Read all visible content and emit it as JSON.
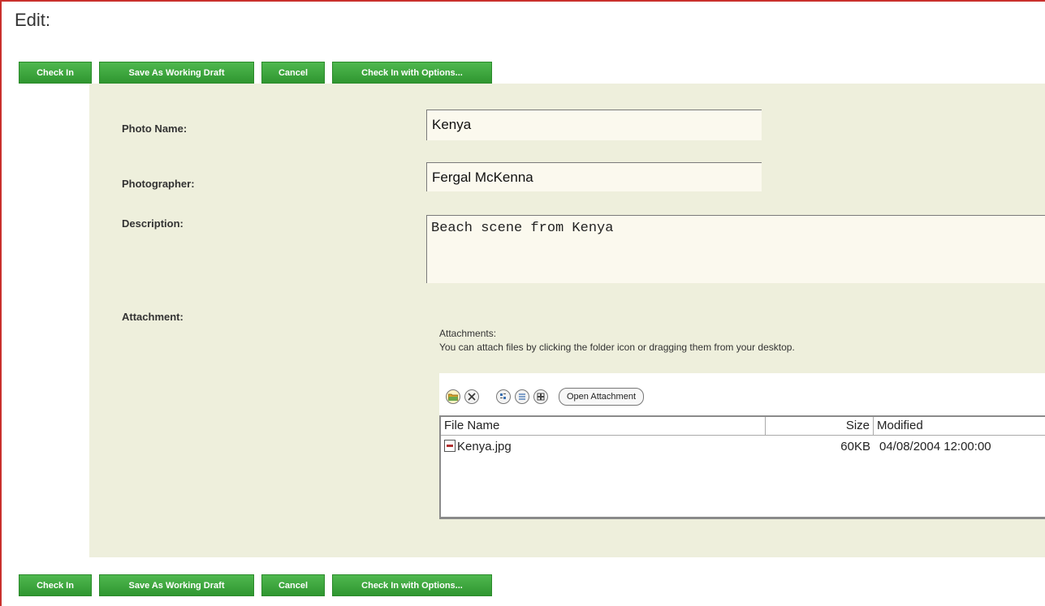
{
  "page": {
    "title": "Edit:"
  },
  "buttons": {
    "check_in": "Check In",
    "save_draft": "Save As Working Draft",
    "cancel": "Cancel",
    "check_in_options": "Check In with Options..."
  },
  "form": {
    "photo_name": {
      "label": "Photo Name:",
      "value": "Kenya"
    },
    "photographer": {
      "label": "Photographer:",
      "value": "Fergal McKenna"
    },
    "description": {
      "label": "Description:",
      "value": "Beach scene from Kenya"
    },
    "attachment": {
      "label": "Attachment:"
    }
  },
  "attachments": {
    "heading": "Attachments:",
    "hint": "You can attach files by clicking the folder icon or dragging them from your desktop.",
    "open_button": "Open Attachment",
    "toolbar_icons": [
      "folder-open-icon",
      "delete-icon",
      "properties-icon",
      "list-view-icon",
      "thumbnail-view-icon"
    ],
    "columns": {
      "name": "File Name",
      "size": "Size",
      "modified": "Modified"
    },
    "files": [
      {
        "name": "Kenya.jpg",
        "size": "60KB",
        "modified": "04/08/2004 12:00:00"
      }
    ]
  },
  "colors": {
    "button": "#3aa63a",
    "panel": "#eeefdc",
    "field": "#fbf9ee",
    "frame": "#c9302c"
  }
}
